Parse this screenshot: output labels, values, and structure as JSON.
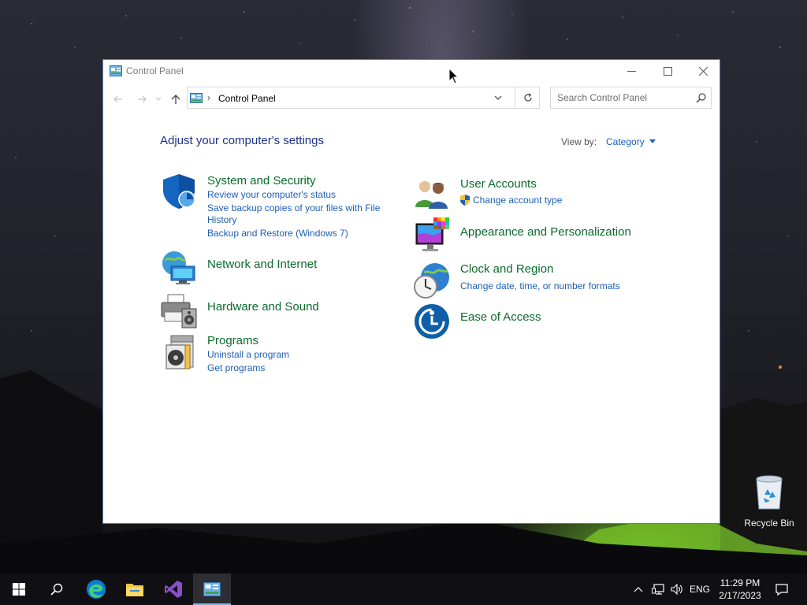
{
  "window": {
    "title": "Control Panel",
    "address_crumb": "Control Panel",
    "search_placeholder": "Search Control Panel"
  },
  "main": {
    "heading": "Adjust your computer's settings",
    "view_by_label": "View by:",
    "view_by_value": "Category"
  },
  "categories": {
    "system_security": {
      "title": "System and Security",
      "links": [
        "Review your computer's status",
        "Save backup copies of your files with File History",
        "Backup and Restore (Windows 7)"
      ]
    },
    "network": {
      "title": "Network and Internet"
    },
    "hardware": {
      "title": "Hardware and Sound"
    },
    "programs": {
      "title": "Programs",
      "links": [
        "Uninstall a program",
        "Get programs"
      ]
    },
    "user_accounts": {
      "title": "User Accounts",
      "links": [
        "Change account type"
      ]
    },
    "appearance": {
      "title": "Appearance and Personalization"
    },
    "clock_region": {
      "title": "Clock and Region",
      "links": [
        "Change date, time, or number formats"
      ]
    },
    "ease": {
      "title": "Ease of Access"
    }
  },
  "desktop": {
    "recycle_bin_label": "Recycle Bin"
  },
  "taskbar": {
    "language": "ENG",
    "time": "11:29 PM",
    "date": "2/17/2023"
  },
  "colors": {
    "category_title": "#0b6a2c",
    "link": "#1e5fb4",
    "heading": "#1e3287",
    "taskbar_active_underline": "#76b9ed"
  },
  "icons": {
    "window_app": "control-panel-icon",
    "start": "windows-logo-icon",
    "search": "search-icon",
    "edge": "edge-icon",
    "explorer": "folder-icon",
    "visual_studio": "visual-studio-icon",
    "control_panel": "control-panel-icon"
  }
}
